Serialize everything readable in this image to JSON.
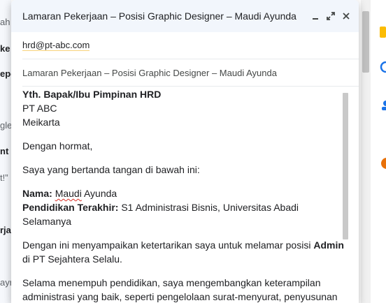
{
  "compose": {
    "title": "Lamaran Pekerjaan – Posisi Graphic Designer – Maudi Ayunda",
    "to": "hrd@pt-abc.com",
    "subject": "Lamaran Pekerjaan – Posisi Graphic Designer – Maudi Ayunda"
  },
  "body": {
    "recipient_line1": "Yth. Bapak/Ibu Pimpinan HRD",
    "recipient_line2": "PT ABC",
    "recipient_line3": "Meikarta",
    "greeting": "Dengan hormat,",
    "intro": "Saya yang bertanda tangan di bawah ini:",
    "name_label": "Nama:",
    "name_value": "Maudi",
    "name_value2": " Ayunda",
    "education_label": "Pendidikan Terakhir:",
    "education_value": " S1 Administrasi Bisnis, Universitas Abadi",
    "education_value2": "Selamanya",
    "interest_pre": "Dengan ini menyampaikan ketertarikan saya untuk melamar posisi ",
    "interest_position": "Admin",
    "interest_post": "di PT Sejahtera Selalu.",
    "experience": "Selama menempuh pendidikan, saya mengembangkan keterampilan administrasi yang baik, seperti pengelolaan surat-menyurat, penyusunan"
  },
  "background": {
    "frag1": "ah",
    "frag2": "ke",
    "frag3": "epo",
    "frag4": "gle",
    "frag5": "nt",
    "frag6": "t!”",
    "frag7": "rja",
    "frag8": "ayr"
  }
}
